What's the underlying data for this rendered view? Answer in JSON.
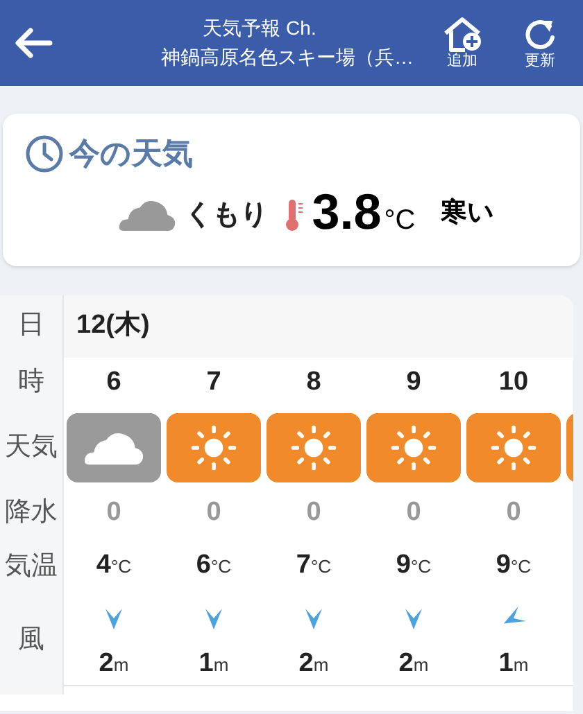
{
  "header": {
    "title": "天気予報 Ch.",
    "subtitle": "神鍋高原名色スキー場（兵…",
    "actions": [
      {
        "kind": "add",
        "label": "追加"
      },
      {
        "kind": "refresh",
        "label": "更新"
      }
    ]
  },
  "now": {
    "heading": "今の天気",
    "icon": {
      "kind": "cloudy"
    },
    "condition": "くもり",
    "temperature": "3.8",
    "unit": "°C",
    "feel": "寒い"
  },
  "forecast": {
    "labels": {
      "day": "日",
      "hour": "時",
      "weather": "天気",
      "precip": "降水",
      "temp": "気温",
      "wind": "風"
    },
    "day": "12(木)",
    "hours": [
      {
        "hour": "6",
        "weather_icon": {
          "kind": "cloudy"
        },
        "precip": "0",
        "temp": "4",
        "temp_unit": "°C",
        "wind_arrow": {
          "kind": "down"
        },
        "wind_speed": "2",
        "wind_unit": "m"
      },
      {
        "hour": "7",
        "weather_icon": {
          "kind": "sunny"
        },
        "precip": "0",
        "temp": "6",
        "temp_unit": "°C",
        "wind_arrow": {
          "kind": "down"
        },
        "wind_speed": "1",
        "wind_unit": "m"
      },
      {
        "hour": "8",
        "weather_icon": {
          "kind": "sunny"
        },
        "precip": "0",
        "temp": "7",
        "temp_unit": "°C",
        "wind_arrow": {
          "kind": "down"
        },
        "wind_speed": "2",
        "wind_unit": "m"
      },
      {
        "hour": "9",
        "weather_icon": {
          "kind": "sunny"
        },
        "precip": "0",
        "temp": "9",
        "temp_unit": "°C",
        "wind_arrow": {
          "kind": "down"
        },
        "wind_speed": "2",
        "wind_unit": "m"
      },
      {
        "hour": "10",
        "weather_icon": {
          "kind": "sunny"
        },
        "precip": "0",
        "temp": "9",
        "temp_unit": "°C",
        "wind_arrow": {
          "kind": "left"
        },
        "wind_speed": "1",
        "wind_unit": "m"
      },
      {
        "weather_icon": {
          "kind": "sunny"
        }
      }
    ]
  }
}
